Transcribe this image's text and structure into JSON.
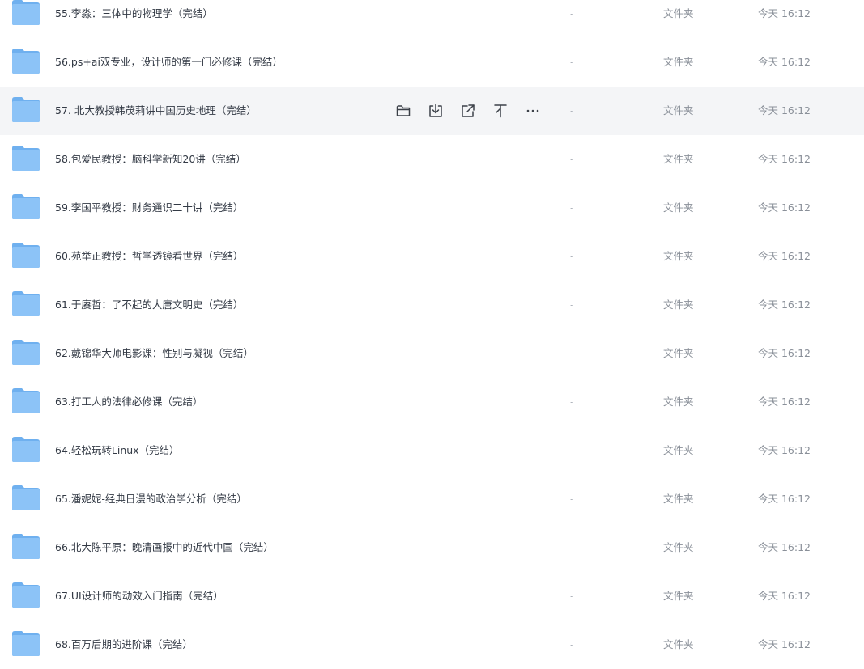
{
  "colors": {
    "folder": "#8cc3f7",
    "folder_tab": "#6fb0ef",
    "hover_row": "#f4f5f7",
    "name_text": "#333a45",
    "meta_text": "#8a9099"
  },
  "hovered_index": 2,
  "row_actions": [
    {
      "icon": "open-folder-icon",
      "name": "open-button"
    },
    {
      "icon": "download-icon",
      "name": "download-button"
    },
    {
      "icon": "share-icon",
      "name": "share-button"
    },
    {
      "icon": "pin-top-icon",
      "name": "pin-top-button"
    },
    {
      "icon": "more-icon",
      "name": "more-button"
    }
  ],
  "files": [
    {
      "name": "55.李淼：三体中的物理学（完结）",
      "size": "-",
      "type": "文件夹",
      "time": "今天 16:12"
    },
    {
      "name": "56.ps+ai双专业，设计师的第一门必修课（完结）",
      "size": "-",
      "type": "文件夹",
      "time": "今天 16:12"
    },
    {
      "name": "57. 北大教授韩茂莉讲中国历史地理（完结）",
      "size": "-",
      "type": "文件夹",
      "time": "今天 16:12"
    },
    {
      "name": "58.包爱民教授：脑科学新知20讲（完结）",
      "size": "-",
      "type": "文件夹",
      "time": "今天 16:12"
    },
    {
      "name": "59.李国平教授：财务通识二十讲（完结）",
      "size": "-",
      "type": "文件夹",
      "time": "今天 16:12"
    },
    {
      "name": "60.苑举正教授：哲学透镜看世界（完结）",
      "size": "-",
      "type": "文件夹",
      "time": "今天 16:12"
    },
    {
      "name": "61.于赓哲：了不起的大唐文明史（完结）",
      "size": "-",
      "type": "文件夹",
      "time": "今天 16:12"
    },
    {
      "name": "62.戴锦华大师电影课：性别与凝视（完结）",
      "size": "-",
      "type": "文件夹",
      "time": "今天 16:12"
    },
    {
      "name": "63.打工人的法律必修课（完结）",
      "size": "-",
      "type": "文件夹",
      "time": "今天 16:12"
    },
    {
      "name": "64.轻松玩转Linux（完结）",
      "size": "-",
      "type": "文件夹",
      "time": "今天 16:12"
    },
    {
      "name": "65.潘妮妮-经典日漫的政治学分析（完结）",
      "size": "-",
      "type": "文件夹",
      "time": "今天 16:12"
    },
    {
      "name": "66.北大陈平原：晚清画报中的近代中国（完结）",
      "size": "-",
      "type": "文件夹",
      "time": "今天 16:12"
    },
    {
      "name": "67.UI设计师的动效入门指南（完结）",
      "size": "-",
      "type": "文件夹",
      "time": "今天 16:12"
    },
    {
      "name": "68.百万后期的进阶课（完结）",
      "size": "-",
      "type": "文件夹",
      "time": "今天 16:12"
    }
  ]
}
